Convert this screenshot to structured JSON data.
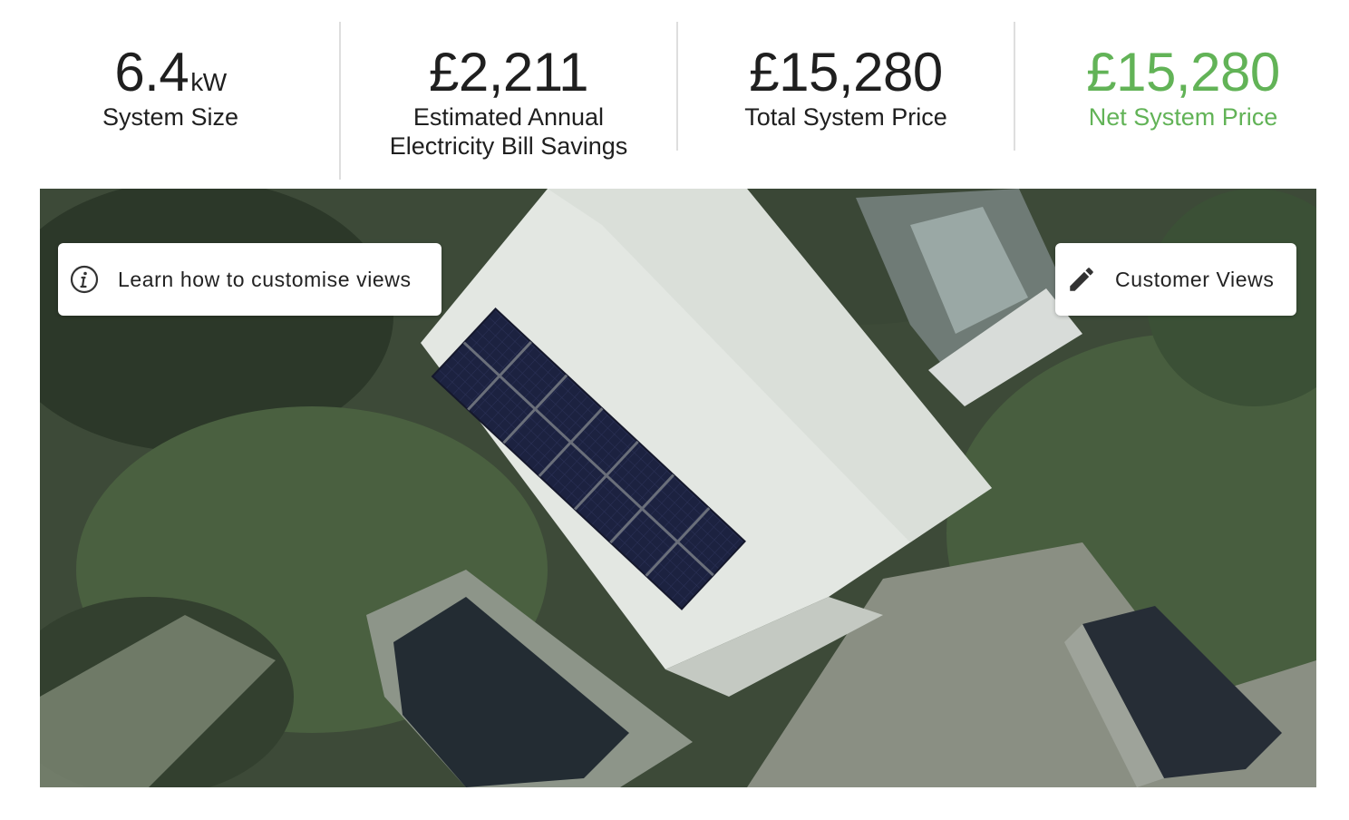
{
  "stats": [
    {
      "value": "6.4",
      "unit": "kW",
      "label_line1": "System Size",
      "label_line2": ""
    },
    {
      "value": "£2,211",
      "unit": "",
      "label_line1": "Estimated Annual",
      "label_line2": "Electricity Bill Savings"
    },
    {
      "value": "£15,280",
      "unit": "",
      "label_line1": "Total System Price",
      "label_line2": ""
    },
    {
      "value": "£15,280",
      "unit": "",
      "label_line1": "Net System Price",
      "label_line2": ""
    }
  ],
  "colors": {
    "net_price": "#62b357",
    "text": "#1f1f1f",
    "divider": "#dedede",
    "panel": "#1c2240"
  },
  "map": {
    "learn_button": {
      "label": "Learn how to customise views",
      "icon": "info-icon"
    },
    "views_button": {
      "label": "Customer Views",
      "icon": "pencil-icon"
    }
  }
}
